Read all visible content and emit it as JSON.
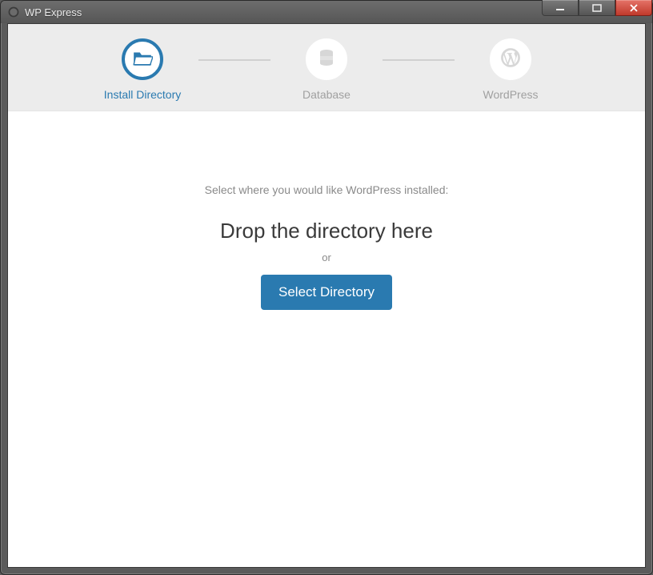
{
  "window": {
    "title": "WP Express"
  },
  "colors": {
    "accent": "#2a7ab0",
    "muted": "#8a8a8a",
    "stepBg": "#ececec"
  },
  "steps": [
    {
      "label": "Install Directory",
      "icon": "folder-open-icon",
      "active": true
    },
    {
      "label": "Database",
      "icon": "database-icon",
      "active": false
    },
    {
      "label": "WordPress",
      "icon": "wordpress-icon",
      "active": false
    }
  ],
  "main": {
    "prompt": "Select where you would like WordPress installed:",
    "drop_heading": "Drop the directory here",
    "or_label": "or",
    "select_button": "Select Directory"
  }
}
